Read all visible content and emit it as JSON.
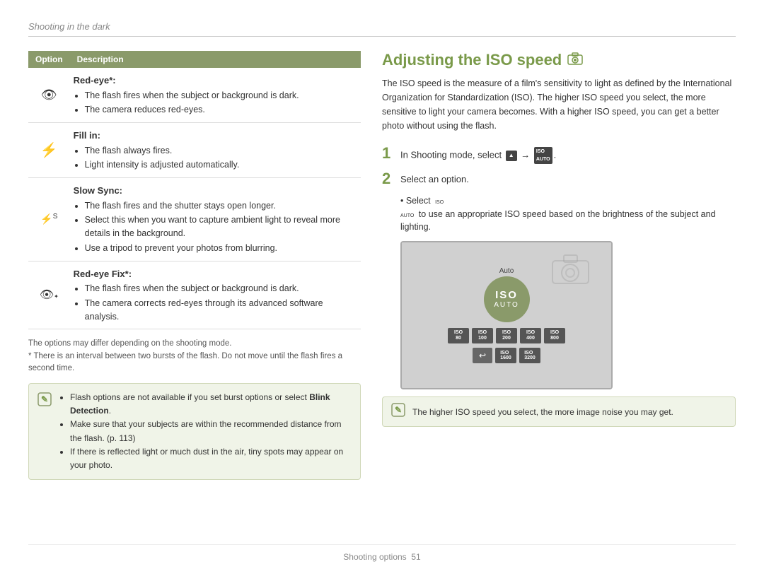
{
  "header": {
    "title": "Shooting in the dark"
  },
  "left": {
    "table": {
      "col1": "Option",
      "col2": "Description",
      "rows": [
        {
          "icon": "👁",
          "title": "Red-eye*:",
          "bullets": [
            "The flash fires when the subject or background is dark.",
            "The camera reduces red-eyes."
          ]
        },
        {
          "icon": "⚡",
          "title": "Fill in:",
          "bullets": [
            "The flash always fires.",
            "Light intensity is adjusted automatically."
          ]
        },
        {
          "icon": "⚡5",
          "title": "Slow Sync:",
          "bullets": [
            "The flash fires and the shutter stays open longer.",
            "Select this when you want to capture ambient light to reveal more details in the background.",
            "Use a tripod to prevent your photos from blurring."
          ]
        },
        {
          "icon": "👁̈",
          "title": "Red-eye Fix*:",
          "bullets": [
            "The flash fires when the subject or background is dark.",
            "The camera corrects red-eyes through its advanced software analysis."
          ]
        }
      ]
    },
    "notes": [
      "The options may differ depending on the shooting mode.",
      "* There is an interval between two bursts of the flash. Do not move until the flash fires a second time."
    ],
    "info_bullets": [
      "Flash options are not available if you set burst options or select Blink Detection.",
      "Make sure that your subjects are within the recommended distance from the flash. (p. 113)",
      "If there is reflected light or much dust in the air, tiny spots may appear on your photo."
    ],
    "info_bold": "Blink Detection"
  },
  "right": {
    "section_title": "Adjusting the ISO speed",
    "intro": "The ISO speed is the measure of a film's sensitivity to light as defined by the International Organization for Standardization (ISO). The higher ISO speed you select, the more sensitive to light your camera becomes. With a higher ISO speed, you can get a better photo without using the flash.",
    "step1": "In Shooting mode, select",
    "step1_icons": [
      "▲",
      "ISO AUTO"
    ],
    "step2": "Select an option.",
    "step2_bullet": "Select ISO AUTO to use an appropriate ISO speed based on the brightness of the subject and lighting.",
    "iso_options": [
      "ISO 80",
      "ISO 100",
      "ISO 200",
      "ISO 400",
      "ISO 800"
    ],
    "iso_options2": [
      "ISO 1600",
      "ISO 3200"
    ],
    "iso_main_label": "ISO",
    "iso_auto": "AUTO",
    "auto_text": "Auto",
    "info_text": "The higher ISO speed you select, the more image noise you may get."
  },
  "footer": {
    "text": "Shooting options",
    "page": "51"
  }
}
